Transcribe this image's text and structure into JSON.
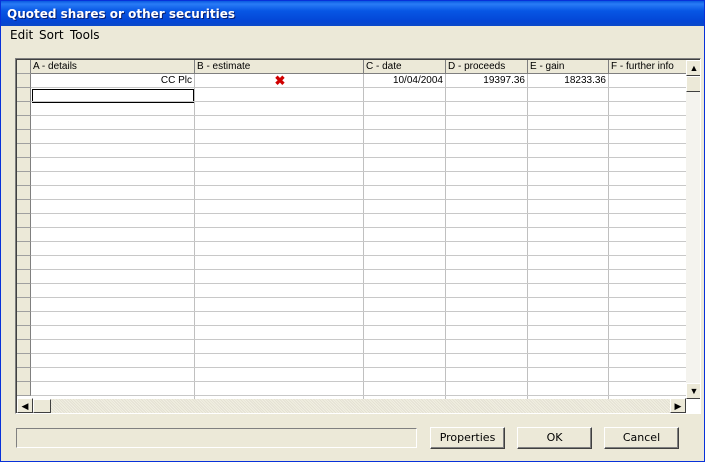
{
  "window": {
    "title": "Quoted shares or other securities"
  },
  "menu": [
    "Edit",
    "Sort",
    "Tools"
  ],
  "table": {
    "columns": [
      "A - details",
      "B - estimate",
      "C - date",
      "D - proceeds",
      "E - gain",
      "F - further info"
    ],
    "rows": [
      {
        "details": "CC Plc",
        "estimate_icon": "red-x-icon",
        "date": "10/04/2004",
        "proceeds": "19397.36",
        "gain": "18233.36",
        "further_info": ""
      }
    ]
  },
  "status": {
    "text": ""
  },
  "buttons": {
    "properties": "Properties",
    "ok": "OK",
    "cancel": "Cancel"
  }
}
